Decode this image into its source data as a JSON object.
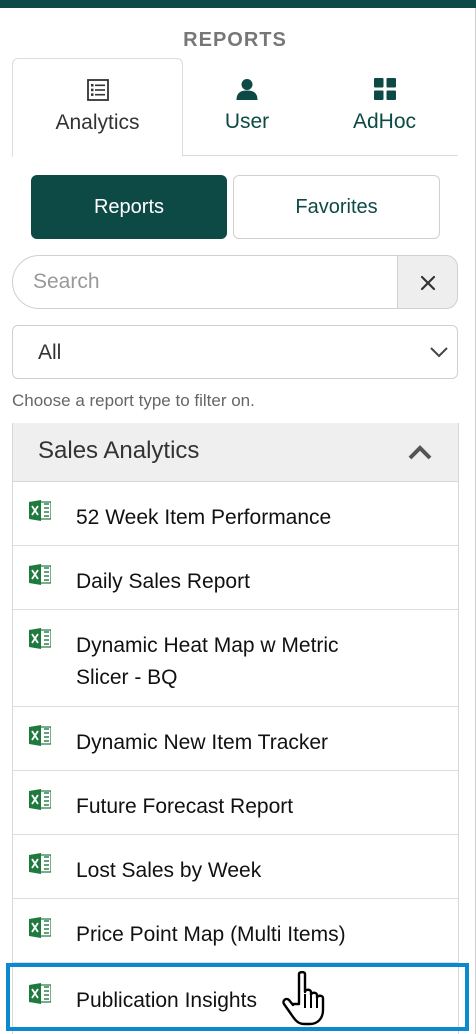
{
  "header": {
    "title": "REPORTS"
  },
  "tabs": [
    {
      "label": "Analytics",
      "icon": "report-list-icon",
      "active": true
    },
    {
      "label": "User",
      "icon": "user-icon",
      "active": false
    },
    {
      "label": "AdHoc",
      "icon": "grid-icon",
      "active": false
    }
  ],
  "toggle": {
    "reports_label": "Reports",
    "favorites_label": "Favorites",
    "selected": "Reports"
  },
  "search": {
    "placeholder": "Search",
    "value": "",
    "clear_icon": "close-icon"
  },
  "filter": {
    "selected": "All",
    "help": "Choose a report type to filter on."
  },
  "group": {
    "title": "Sales Analytics",
    "expanded": true,
    "items": [
      {
        "label": "52 Week Item Performance",
        "icon": "excel-icon"
      },
      {
        "label": "Daily Sales Report",
        "icon": "excel-icon"
      },
      {
        "label": "Dynamic Heat Map w Metric Slicer - BQ",
        "icon": "excel-icon"
      },
      {
        "label": "Dynamic New Item Tracker",
        "icon": "excel-icon"
      },
      {
        "label": "Future Forecast Report",
        "icon": "excel-icon"
      },
      {
        "label": "Lost Sales by Week",
        "icon": "excel-icon"
      },
      {
        "label": "Price Point Map (Multi Items)",
        "icon": "excel-icon"
      },
      {
        "label": "Publication Insights",
        "icon": "excel-icon",
        "highlighted": true
      }
    ]
  },
  "colors": {
    "brand": "#0e4a45",
    "highlight": "#0a89cf",
    "excel": "#1f7a3e"
  }
}
